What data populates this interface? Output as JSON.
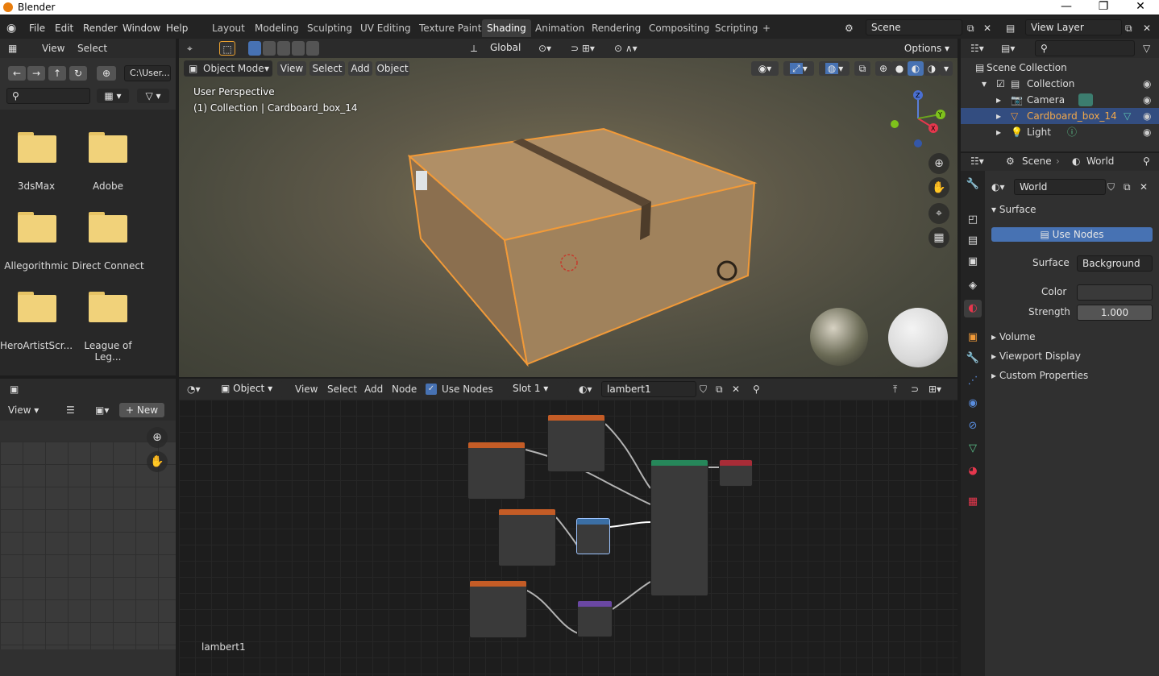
{
  "window": {
    "title": "Blender",
    "minimize": "—",
    "maximize": "❐",
    "close": "✕"
  },
  "menu": [
    "File",
    "Edit",
    "Render",
    "Window",
    "Help"
  ],
  "workspaces": [
    "Layout",
    "Modeling",
    "Sculpting",
    "UV Editing",
    "Texture Paint",
    "Shading",
    "Animation",
    "Rendering",
    "Compositing",
    "Scripting"
  ],
  "workspace_add": "+",
  "scene": {
    "name": "Scene",
    "view_layer": "View Layer"
  },
  "filebrowser": {
    "menu": [
      "View",
      "Select"
    ],
    "path": "C:\\User...",
    "folders": [
      "3dsMax",
      "Adobe",
      "Allegorithmic",
      "Direct Connect",
      "HeroArtistScr...",
      "League of Leg..."
    ]
  },
  "viewport": {
    "mode": "Object Mode",
    "menu": [
      "View",
      "Select",
      "Add",
      "Object"
    ],
    "transform": "Global",
    "options": "Options",
    "perspective": "User Perspective",
    "collection_info": "(1) Collection | Cardboard_box_14",
    "gizmo": {
      "x": "X",
      "y": "Y",
      "z": "Z"
    }
  },
  "image_editor": {
    "view": "View",
    "new": "New"
  },
  "node_editor": {
    "type": "Object",
    "menu": [
      "View",
      "Select",
      "Add",
      "Node"
    ],
    "use_nodes": "Use Nodes",
    "slot": "Slot 1",
    "material": "lambert1",
    "footer_label": "lambert1"
  },
  "outliner": {
    "root": "Scene Collection",
    "collection": "Collection",
    "items": [
      "Camera",
      "Cardboard_box_14",
      "Light"
    ]
  },
  "properties": {
    "tabs": [
      "Scene",
      "World"
    ],
    "world_name": "World",
    "surface_header": "Surface",
    "use_nodes": "Use Nodes",
    "surface_label": "Surface",
    "surface_value": "Background",
    "color_label": "Color",
    "strength_label": "Strength",
    "strength_value": "1.000",
    "panels": [
      "Volume",
      "Viewport Display",
      "Custom Properties"
    ]
  }
}
